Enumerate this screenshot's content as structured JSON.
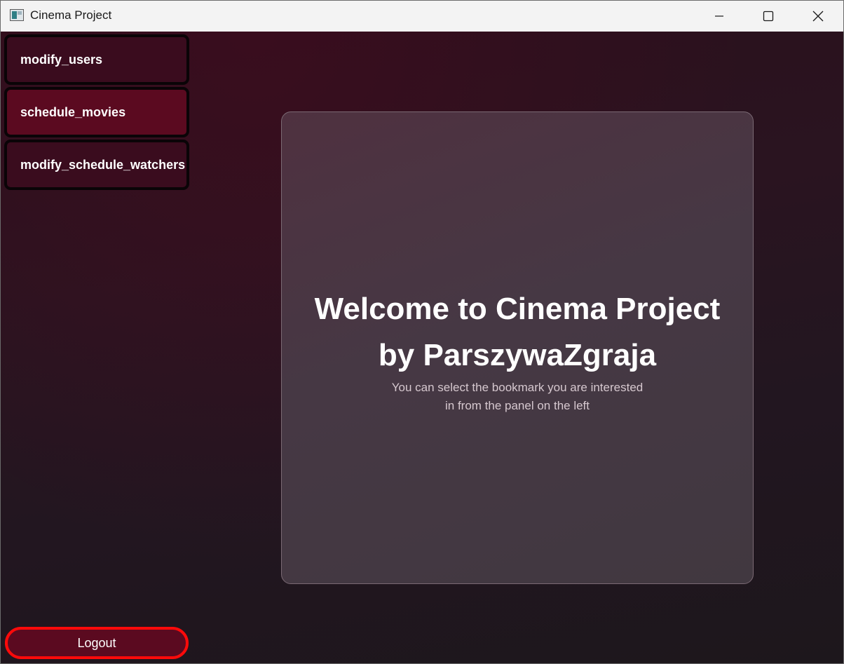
{
  "window": {
    "title": "Cinema Project",
    "controls": [
      "minimize-icon",
      "maximize-icon",
      "close-icon"
    ]
  },
  "sidebar": {
    "items": [
      {
        "label": "modify_users",
        "active": false
      },
      {
        "label": "schedule_movies",
        "active": true
      },
      {
        "label": "modify_schedule_watchers",
        "active": false
      }
    ],
    "logout_label": "Logout"
  },
  "main": {
    "title_line1": "Welcome to Cinema Project",
    "title_line2": "by ParszywaZgraja",
    "subtitle_line1": "You can select the bookmark you are interested",
    "subtitle_line2": "in from the panel on the left"
  },
  "colors": {
    "button_bg": "#3a0c1e",
    "button_active_bg": "#5b0a20",
    "highlight": "#ff0a0a",
    "card_bg": "#4a3541"
  }
}
